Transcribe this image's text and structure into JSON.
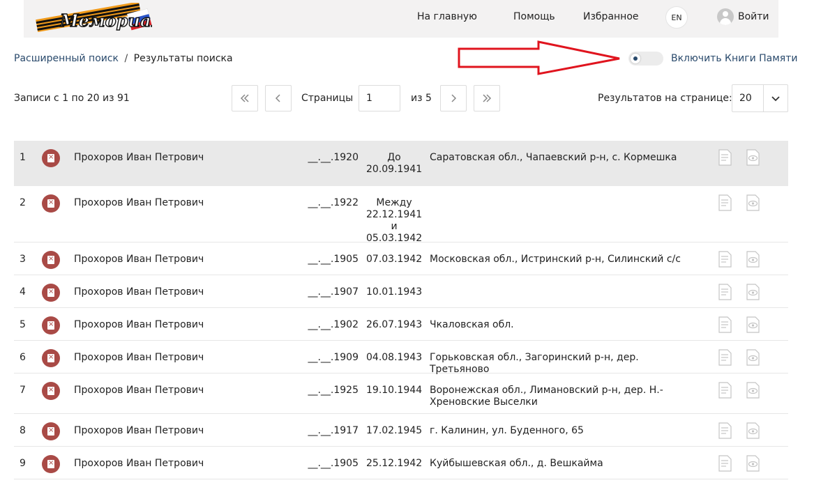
{
  "header": {
    "logo_text": "Мемориал",
    "nav": [
      "На главную",
      "Помощь",
      "Избранное"
    ],
    "lang": "EN",
    "login": "Войти"
  },
  "breadcrumb": {
    "link": "Расширенный поиск",
    "separator": "/",
    "current": "Результаты поиска"
  },
  "toggle": {
    "label": "Включить Книги Памяти",
    "on": false
  },
  "pagination": {
    "records_info": "Записи с 1 по 20 из 91",
    "pages_label": "Страницы",
    "current_page": "1",
    "of_label": "из 5",
    "per_page_label": "Результатов на странице:",
    "per_page_value": "20"
  },
  "colors": {
    "accent_link": "#2a4a6c",
    "badge": "#a94a46",
    "arrow": "#e0141e"
  },
  "rows": [
    {
      "num": "1",
      "name": "Прохоров Иван Петрович",
      "birth": "__.__.1920",
      "death": "До 20.09.1941",
      "place": "Саратовская обл., Чапаевский р-н, с. Кормешка"
    },
    {
      "num": "2",
      "name": "Прохоров Иван Петрович",
      "birth": "__.__.1922",
      "death": "Между 22.12.1941 и 05.03.1942",
      "place": ""
    },
    {
      "num": "3",
      "name": "Прохоров Иван Петрович",
      "birth": "__.__.1905",
      "death": "07.03.1942",
      "place": "Московская обл., Истринский р-н, Силинский с/с"
    },
    {
      "num": "4",
      "name": "Прохоров Иван Петрович",
      "birth": "__.__.1907",
      "death": "10.01.1943",
      "place": ""
    },
    {
      "num": "5",
      "name": "Прохоров Иван Петрович",
      "birth": "__.__.1902",
      "death": "26.07.1943",
      "place": "Чкаловская обл."
    },
    {
      "num": "6",
      "name": "Прохоров Иван Петрович",
      "birth": "__.__.1909",
      "death": "04.08.1943",
      "place": "Горьковская обл., Загоринский р-н, дер. Третьяново"
    },
    {
      "num": "7",
      "name": "Прохоров Иван Петрович",
      "birth": "__.__.1925",
      "death": "19.10.1944",
      "place": "Воронежская обл., Лимановский р-н, дер. Н.-Хреновские Выселки"
    },
    {
      "num": "8",
      "name": "Прохоров Иван Петрович",
      "birth": "__.__.1917",
      "death": "17.02.1945",
      "place": "г. Калинин, ул. Буденного, 65"
    },
    {
      "num": "9",
      "name": "Прохоров Иван Петрович",
      "birth": "__.__.1905",
      "death": "25.12.1942",
      "place": "Куйбышевская обл., д. Вешкайма"
    }
  ]
}
